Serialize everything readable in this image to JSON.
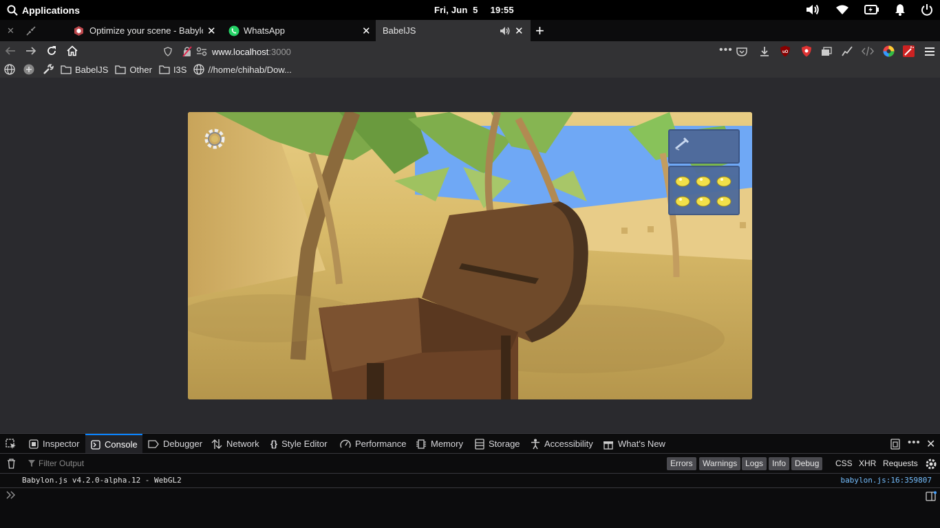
{
  "topbar": {
    "apps_label": "Applications",
    "date": "Fri, Jun  5",
    "time": "19:55"
  },
  "tabs": [
    {
      "title": "Optimize your scene - Babylon.js",
      "favicon": "babylon-icon"
    },
    {
      "title": "WhatsApp",
      "favicon": "whatsapp-icon"
    },
    {
      "title": "BabelJS",
      "favicon": "",
      "audio": true,
      "active": true
    }
  ],
  "url": {
    "host": "www.localhost",
    "port": ":3000"
  },
  "bookmarks": [
    {
      "label": "BabelJS",
      "icon": "folder-icon"
    },
    {
      "label": "Other",
      "icon": "folder-icon"
    },
    {
      "label": "I3S",
      "icon": "folder-icon"
    },
    {
      "label": "//home/chihab/Dow...",
      "icon": "globe-icon"
    }
  ],
  "devtools": {
    "tabs": [
      "Inspector",
      "Console",
      "Debugger",
      "Network",
      "Style Editor",
      "Performance",
      "Memory",
      "Storage",
      "Accessibility",
      "What's New"
    ],
    "active_tab": "Console",
    "filter_placeholder": "Filter Output",
    "level_filters": [
      "Errors",
      "Warnings",
      "Logs",
      "Info",
      "Debug"
    ],
    "type_filters": [
      "CSS",
      "XHR",
      "Requests"
    ],
    "log_message": "Babylon.js v4.2.0-alpha.12 - WebGL2",
    "log_source": "babylon.js:16:359807"
  },
  "colors": {
    "accent": "#0a84ff",
    "link": "#75bfff",
    "sky": "#6fa8f5",
    "sand": "#d9b85f"
  }
}
